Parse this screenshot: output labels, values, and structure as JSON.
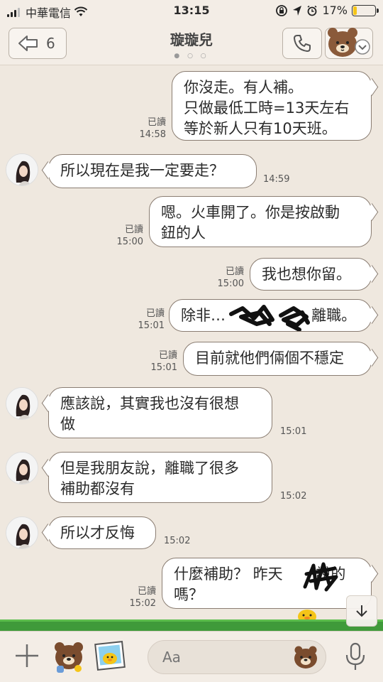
{
  "status": {
    "carrier": "中華電信",
    "time": "13:15",
    "battery": "17%",
    "battery_level": 0.17
  },
  "header": {
    "unread_count": "6",
    "title": "璇璇兒",
    "page_dots": "● ○ ○"
  },
  "messages": [
    {
      "dir": "out",
      "text": "你沒走。有人補。\n只做最低工時=13天左右\n等於新人只有10天班。",
      "read": "已讀",
      "time": "14:58"
    },
    {
      "dir": "in",
      "text": "所以現在是我一定要走？",
      "time": "14:59"
    },
    {
      "dir": "out",
      "text": "嗯。火車開了。你是按啟動\n鈕的人",
      "read": "已讀",
      "time": "15:00"
    },
    {
      "dir": "out",
      "text": "我也想你留。",
      "read": "已讀",
      "time": "15:00"
    },
    {
      "dir": "out",
      "text": "除非…        、       離職。",
      "read": "已讀",
      "time": "15:01"
    },
    {
      "dir": "out",
      "text": "目前就他們倆個不穩定",
      "read": "已讀",
      "time": "15:01"
    },
    {
      "dir": "in",
      "text": "應該說，其實我也沒有很想\n做",
      "time": "15:01"
    },
    {
      "dir": "in",
      "text": "但是我朋友說，離職了很多\n補助都沒有",
      "time": "15:02"
    },
    {
      "dir": "in",
      "text": "所以才反悔",
      "time": "15:02"
    },
    {
      "dir": "out",
      "text": "什麼補助？ 昨天       說的\n嗎？",
      "read": "已讀",
      "time": "15:02"
    }
  ],
  "input": {
    "placeholder": "Aa"
  },
  "icons": {
    "back": "back-arrow-icon",
    "call": "phone-icon",
    "menu": "brown-bear-icon",
    "down": "arrow-down-icon",
    "plus": "plus-icon",
    "sticker": "bear-sticker-icon",
    "photo": "photo-icon",
    "emoji": "bear-emoji-icon",
    "mic": "microphone-icon"
  }
}
